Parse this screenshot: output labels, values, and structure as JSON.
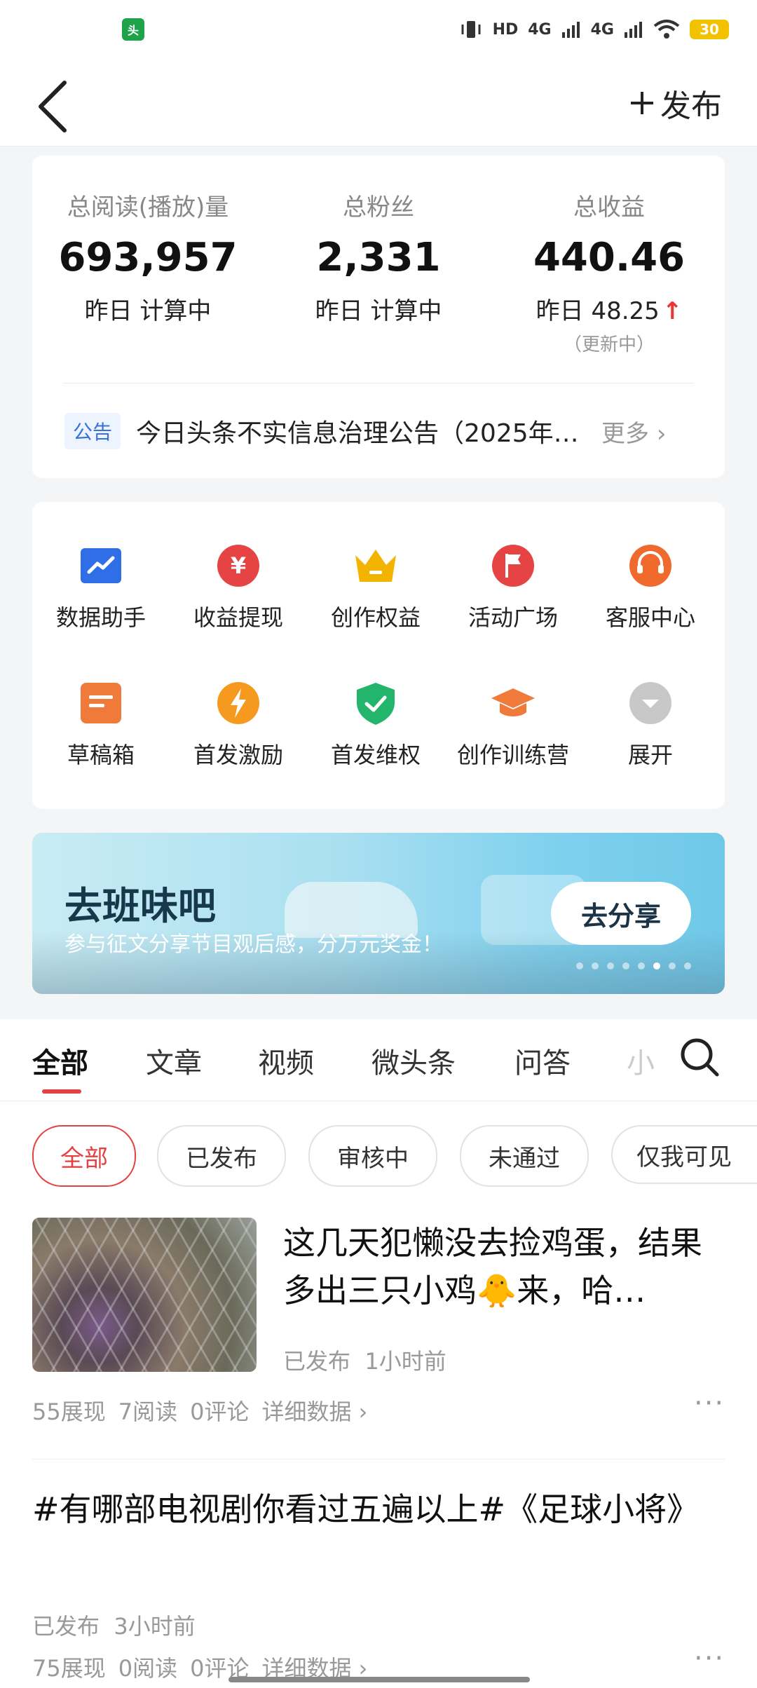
{
  "status_bar": {
    "app_badge": "头",
    "hd": "HD",
    "net1": "4G",
    "net2": "4G",
    "battery": "30"
  },
  "header": {
    "publish_label": "发布"
  },
  "stats": {
    "items": [
      {
        "label": "总阅读(播放)量",
        "value": "693,957",
        "sub": "昨日 计算中"
      },
      {
        "label": "总粉丝",
        "value": "2,331",
        "sub": "昨日 计算中"
      },
      {
        "label": "总收益",
        "value": "440.46",
        "sub": "昨日 48.25",
        "note": "（更新中）"
      }
    ],
    "notice": {
      "tag": "公告",
      "text": "今日头条不实信息治理公告（2025年…",
      "more": "更多"
    }
  },
  "tools": [
    {
      "label": "数据助手",
      "icon": "data-chart-icon",
      "color": "#2f6ee6"
    },
    {
      "label": "收益提现",
      "icon": "yuan-icon",
      "color": "#e64444"
    },
    {
      "label": "创作权益",
      "icon": "crown-icon",
      "color": "#f3b400"
    },
    {
      "label": "活动广场",
      "icon": "flag-icon",
      "color": "#e64444"
    },
    {
      "label": "客服中心",
      "icon": "headset-icon",
      "color": "#f06a2e"
    },
    {
      "label": "草稿箱",
      "icon": "draft-icon",
      "color": "#f07a3a"
    },
    {
      "label": "首发激励",
      "icon": "lightning-icon",
      "color": "#f59a1e"
    },
    {
      "label": "首发维权",
      "icon": "shield-check-icon",
      "color": "#22b56b"
    },
    {
      "label": "创作训练营",
      "icon": "graduation-cap-icon",
      "color": "#f07a3a"
    },
    {
      "label": "展开",
      "icon": "expand-icon",
      "color": "#c8c8c8"
    }
  ],
  "banner": {
    "title": "去班味吧",
    "subtitle": "参与征文分享节目观后感，分万元奖金！",
    "button": "去分享",
    "slides": 8,
    "active_slide": 5
  },
  "tabs": {
    "items": [
      "全部",
      "文章",
      "视频",
      "微头条",
      "问答",
      "小"
    ],
    "active": 0
  },
  "filters": {
    "items": [
      "全部",
      "已发布",
      "审核中",
      "未通过",
      "仅我可见"
    ],
    "active": 0
  },
  "articles": [
    {
      "title": "这几天犯懒没去捡鸡蛋，结果多出三只小鸡🐥来，哈…",
      "status": "已发布",
      "time": "1小时前",
      "impressions": "55展现",
      "reads": "7阅读",
      "comments": "0评论",
      "detail": "详细数据"
    },
    {
      "title": "#有哪部电视剧你看过五遍以上#《足球小将》",
      "status": "已发布",
      "time": "3小时前",
      "impressions": "75展现",
      "reads": "0阅读",
      "comments": "0评论",
      "detail": "详细数据"
    }
  ],
  "colors": {
    "accent": "#e34242",
    "notice_tag": "#3a73d8"
  }
}
